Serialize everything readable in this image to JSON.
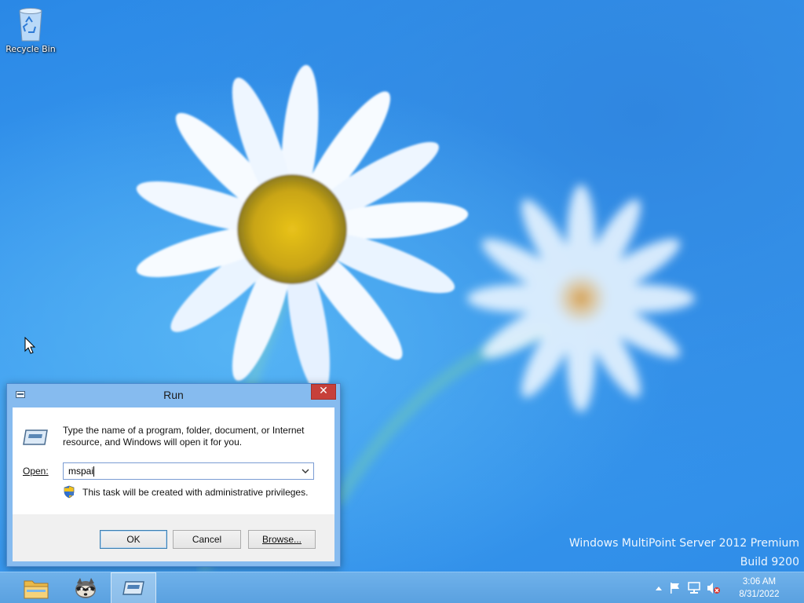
{
  "desktop": {
    "icons": [
      {
        "label": "Recycle Bin",
        "icon": "recycle-bin-icon"
      }
    ],
    "watermark": {
      "line1": "Windows MultiPoint Server 2012 Premium",
      "line2": "Build 9200"
    },
    "wallpaper": "daisy-flowers-on-blue"
  },
  "run_dialog": {
    "title": "Run",
    "close_label": "✕",
    "description": "Type the name of a program, folder, document, or Internet resource, and Windows will open it for you.",
    "open_label": "Open:",
    "open_value": "mspai",
    "admin_note": "This task will be created with administrative privileges.",
    "buttons": {
      "ok": "OK",
      "cancel": "Cancel",
      "browse": "Browse..."
    }
  },
  "taskbar": {
    "pinned": [
      {
        "name": "file-explorer",
        "icon": "folder-icon"
      },
      {
        "name": "raccoon-app",
        "icon": "raccoon-icon"
      },
      {
        "name": "run",
        "icon": "run-icon",
        "active": true
      }
    ],
    "tray": {
      "icons": [
        "show-hidden-icons-icon",
        "action-center-flag-icon",
        "network-icon",
        "volume-muted-icon"
      ],
      "time": "3:06 AM",
      "date": "8/31/2022"
    }
  },
  "colors": {
    "desktop_blue": "#3a94e8",
    "dialog_frame": "#86bbef",
    "close_red": "#c7403a",
    "taskbar": "#5aa1e0"
  }
}
